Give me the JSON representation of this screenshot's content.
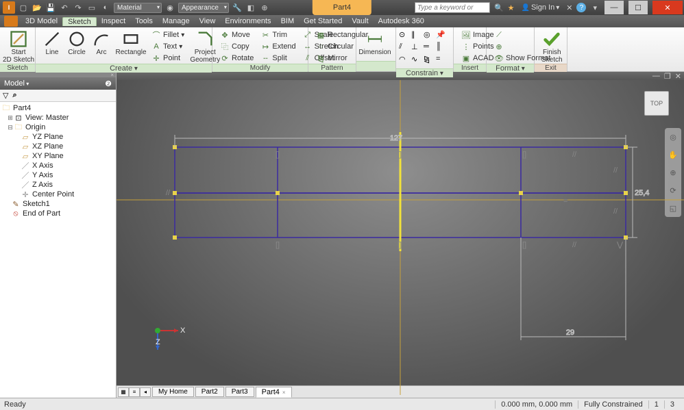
{
  "title": "Part4",
  "qat": {
    "material_label": "Material",
    "appearance_label": "Appearance"
  },
  "search_placeholder": "Type a keyword or",
  "signin": "Sign In",
  "menus": [
    "3D Model",
    "Sketch",
    "Inspect",
    "Tools",
    "Manage",
    "View",
    "Environments",
    "BIM",
    "Get Started",
    "Vault",
    "Autodesk 360"
  ],
  "active_menu": 1,
  "ribbon": {
    "sketch_group": "Sketch",
    "start_sketch": "Start\n2D Sketch",
    "create_group": "Create",
    "line": "Line",
    "circle": "Circle",
    "arc": "Arc",
    "rectangle": "Rectangle",
    "fillet": "Fillet",
    "text": "Text",
    "point": "Point",
    "project": "Project\nGeometry",
    "modify_group": "Modify",
    "move": "Move",
    "trim": "Trim",
    "scale": "Scale",
    "copy": "Copy",
    "extend": "Extend",
    "stretch": "Stretch",
    "rotate": "Rotate",
    "split": "Split",
    "offset": "Offset",
    "pattern_group": "Pattern",
    "rectangular": "Rectangular",
    "circular": "Circular",
    "mirror": "Mirror",
    "dimension": "Dimension",
    "constrain_group": "Constrain",
    "insert_group": "Insert",
    "image": "Image",
    "points": "Points",
    "acad": "ACAD",
    "format_group": "Format",
    "show_format": "Show Format",
    "exit_group": "Exit",
    "finish": "Finish\nSketch"
  },
  "browser": {
    "header": "Model",
    "root": "Part4",
    "view": "View: Master",
    "origin": "Origin",
    "planes": [
      "YZ Plane",
      "XZ Plane",
      "XY Plane"
    ],
    "axes": [
      "X Axis",
      "Y Axis",
      "Z Axis"
    ],
    "center": "Center Point",
    "sketch": "Sketch1",
    "end": "End of Part"
  },
  "viewcube": "TOP",
  "dims": {
    "top": "127",
    "right": "25,4",
    "bottom": "29"
  },
  "tabs": [
    "My Home",
    "Part2",
    "Part3",
    "Part4"
  ],
  "active_tab": 3,
  "status": {
    "left": "Ready",
    "coords": "0.000 mm, 0.000 mm",
    "constraint": "Fully Constrained",
    "n1": "1",
    "n2": "3"
  },
  "ucs": {
    "x": "X",
    "z": "Z"
  }
}
